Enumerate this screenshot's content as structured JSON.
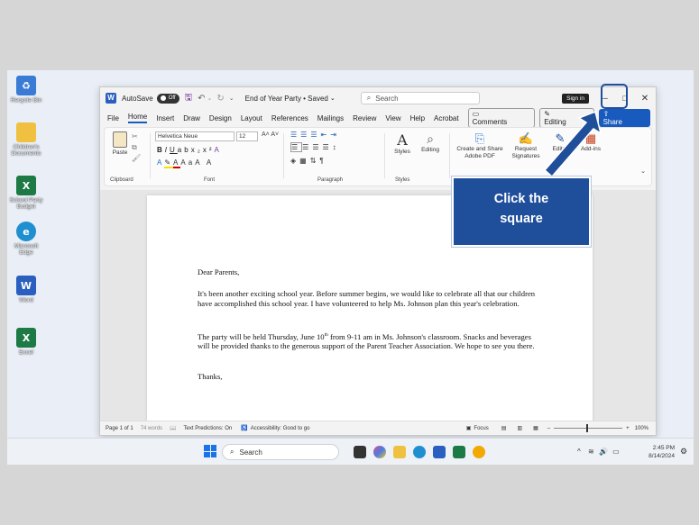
{
  "desktop": {
    "icons": [
      {
        "name": "recycle-bin",
        "label": "Recycle Bin",
        "color": "#3a7bd5"
      },
      {
        "name": "folder-documents",
        "label": "Children's Documents",
        "color": "#f0c040"
      },
      {
        "name": "excel-file",
        "label": "School Party Budget",
        "color": "#1d7a45"
      },
      {
        "name": "edge",
        "label": "Microsoft Edge",
        "color": "#1f8fcf"
      },
      {
        "name": "word",
        "label": "Word",
        "color": "#2b5fbf"
      },
      {
        "name": "excel",
        "label": "Excel",
        "color": "#1d7a45"
      }
    ]
  },
  "titlebar": {
    "autosave": "AutoSave",
    "toggle": "Off",
    "doc_title": "End of Year Party • Saved",
    "search_placeholder": "Search",
    "signin": "Sign in"
  },
  "menu_tabs": [
    "File",
    "Home",
    "Insert",
    "Draw",
    "Design",
    "Layout",
    "References",
    "Mailings",
    "Review",
    "View",
    "Help",
    "Acrobat"
  ],
  "right_buttons": {
    "comments": "Comments",
    "editing": "Editing",
    "share": "Share"
  },
  "ribbon": {
    "paste": "Paste",
    "clipboard": "Clipboard",
    "font_name": "Helvetica Neue",
    "font_size": "12",
    "font": "Font",
    "paragraph": "Paragraph",
    "styles": "Styles",
    "styles_group": "Styles",
    "editing": "Editing",
    "create_share": "Create and Share Adobe PDF",
    "request": "Request Signatures",
    "editor": "Editor",
    "addins": "Add-ins"
  },
  "document": {
    "greeting": "Dear Parents,",
    "para1": "It's been another exciting school year. Before summer begins, we would like to celebrate all that our children have accomplished this school year. I have volunteered to help Ms. Johnson plan this year's celebration.",
    "para2": "The party will be held Thursday, June 10th from 9-11 am in Ms. Johnson's classroom. Snacks and beverages will be provided thanks to the generous support of the Parent Teacher Association. We hope to see you there.",
    "closing": "Thanks,"
  },
  "status": {
    "page": "Page 1 of 1",
    "words": "74 words",
    "predictions": "Text Predictions: On",
    "accessibility": "Accessibility: Good to go",
    "focus": "Focus",
    "zoom": "100%"
  },
  "taskbar": {
    "search": "Search",
    "time": "2:45 PM",
    "date": "8/14/2024"
  },
  "callout": {
    "text": "Click the square"
  },
  "colors": {
    "callout_bg": "#1f4e9b",
    "accent": "#185abd"
  }
}
